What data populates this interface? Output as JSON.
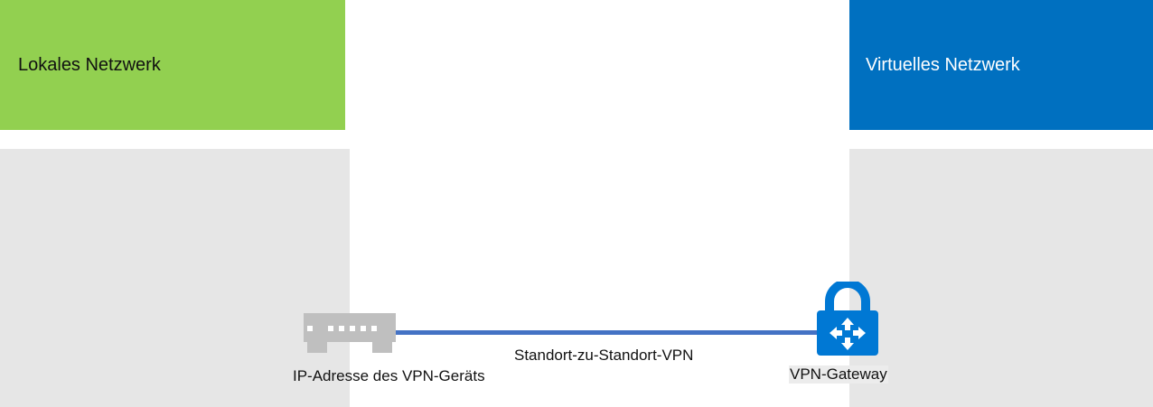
{
  "local_network": {
    "title": "Lokales Netzwerk",
    "color": "#92d050",
    "device_label": "IP-Adresse des VPN-Geräts",
    "device_icon": "vpn-device-icon"
  },
  "virtual_network": {
    "title": "Virtuelles Netzwerk",
    "color": "#0070c0",
    "gateway_label": "VPN-Gateway",
    "gateway_icon": "vpn-gateway-lock-icon"
  },
  "connection": {
    "label": "Standort-zu-Standort-VPN",
    "color": "#4472c4"
  },
  "panel_color": "#e6e6e6"
}
